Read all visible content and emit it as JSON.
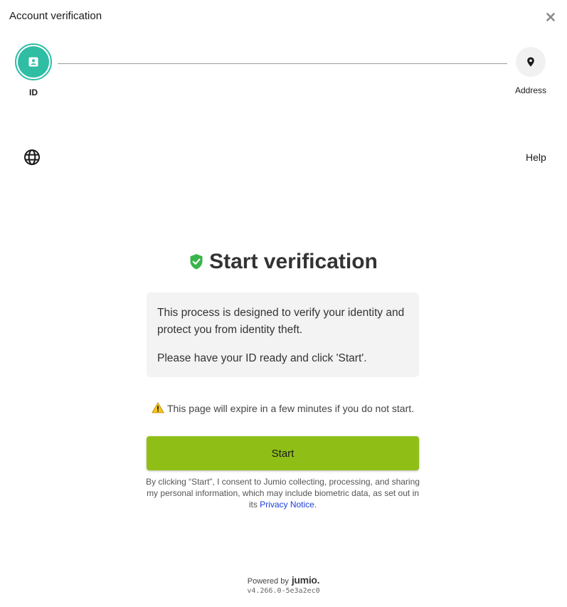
{
  "dialog": {
    "title": "Account verification"
  },
  "stepper": {
    "steps": [
      {
        "label": "ID",
        "icon": "id-card-icon",
        "state": "active"
      },
      {
        "label": "Address",
        "icon": "location-pin-icon",
        "state": "inactive"
      }
    ],
    "active_color": "#2fbda4"
  },
  "toolbar": {
    "language_icon": "globe-icon",
    "help_label": "Help"
  },
  "main": {
    "title": "Start verification",
    "title_icon": "shield-check-icon",
    "info_paragraphs": [
      "This process is designed to verify your identity and protect you from identity theft.",
      "Please have your ID ready and click 'Start'."
    ],
    "expire_note": "This page will expire in a few minutes if you do not start.",
    "start_label": "Start",
    "start_color": "#8fbf17",
    "consent_text": "By clicking “Start”, I consent to Jumio collecting, processing, and sharing my personal information, which may include biometric data, as set out in its",
    "privacy_link": "Privacy Notice",
    "consent_end": "."
  },
  "footer": {
    "powered_by": "Powered by",
    "brand": "jumio.",
    "version": "v4.266.0-5e3a2ec0"
  }
}
